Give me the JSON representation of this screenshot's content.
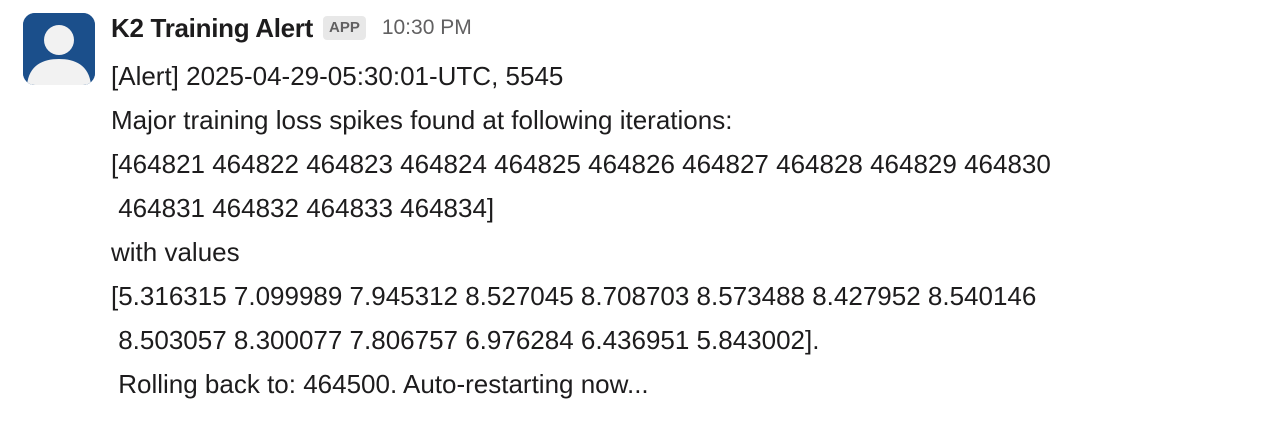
{
  "message": {
    "sender": "K2 Training Alert",
    "badge": "APP",
    "time": "10:30 PM",
    "lines": [
      "[Alert] 2025-04-29-05:30:01-UTC, 5545",
      "Major training loss spikes found at following iterations:",
      "[464821 464822 464823 464824 464825 464826 464827 464828 464829 464830",
      " 464831 464832 464833 464834]",
      "with values",
      "[5.316315 7.099989 7.945312 8.527045 8.708703 8.573488 8.427952 8.540146",
      " 8.503057 8.300077 7.806757 6.976284 6.436951 5.843002].",
      " Rolling back to: 464500. Auto-restarting now..."
    ]
  },
  "colors": {
    "avatar_bg": "#1b4f8b",
    "avatar_fg": "#f2f2f2",
    "text": "#1d1c1d",
    "muted": "#616061",
    "badge_bg": "#e8e8e8"
  },
  "icons": {
    "avatar": "default-user-silhouette-icon"
  }
}
